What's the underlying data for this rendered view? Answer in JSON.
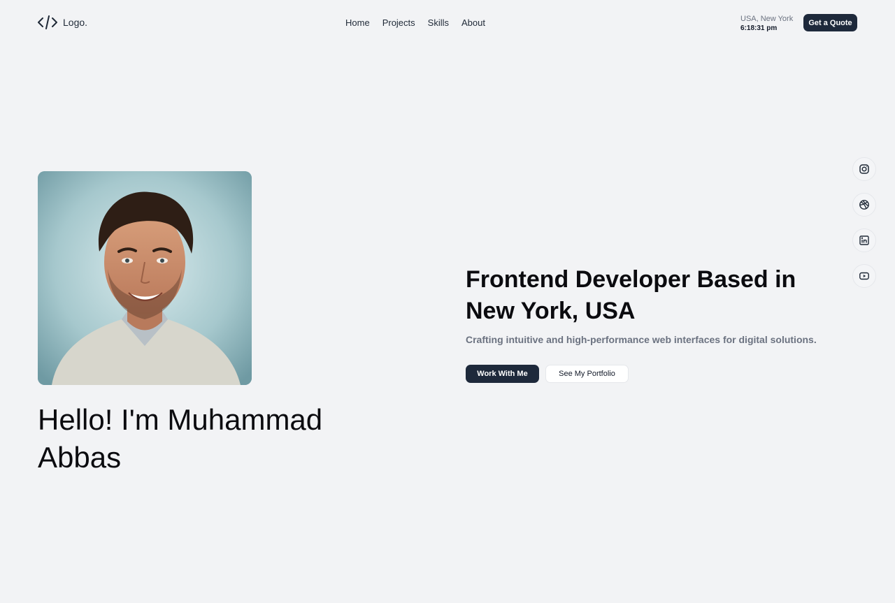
{
  "header": {
    "logo_text": "Logo.",
    "nav": [
      {
        "label": "Home"
      },
      {
        "label": "Projects"
      },
      {
        "label": "Skills"
      },
      {
        "label": "About"
      }
    ],
    "location": "USA, New York",
    "time": "6:18:31 pm",
    "cta_label": "Get a Quote"
  },
  "profile": {
    "greeting": "Hello! I'm Muhammad Abbas"
  },
  "hero": {
    "title": "Frontend Developer Based in New York, USA",
    "subtitle": "Crafting intuitive and high-performance web interfaces for digital solutions.",
    "primary_label": "Work With Me",
    "secondary_label": "See My Portfolio"
  },
  "social": [
    {
      "icon": "instagram-icon"
    },
    {
      "icon": "dribbble-icon"
    },
    {
      "icon": "linkedin-icon"
    },
    {
      "icon": "youtube-icon"
    }
  ],
  "colors": {
    "background": "#f2f3f5",
    "primary": "#1e293b",
    "text": "#0b0b0f",
    "muted": "#6b7280"
  }
}
